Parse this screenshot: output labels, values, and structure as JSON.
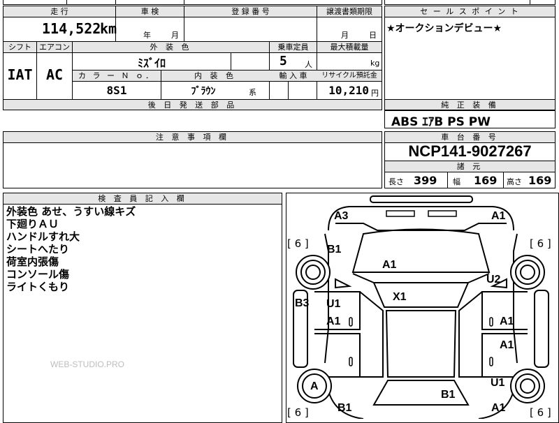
{
  "top_strip": {
    "mileage_label": "走 行",
    "inspection_label": "車 検",
    "registration_label": "登 録 番 号",
    "transfer_deadline_label": "譲渡書類期限"
  },
  "mileage": {
    "value": "114,522",
    "unit": "km"
  },
  "inspection": {
    "year_label": "年",
    "month_label": "月"
  },
  "transfer": {
    "month_label": "月",
    "day_label": "日"
  },
  "row2_labels": {
    "shift": "シフト",
    "aircon": "エアコン",
    "exterior_color": "外 装 色",
    "capacity": "乗車定員",
    "max_load": "最大積載量"
  },
  "shift": "IAT",
  "aircon": "AC",
  "exterior_color": "ﾐｽﾞｲﾛ",
  "capacity": {
    "value": "5",
    "unit": "人"
  },
  "max_load": {
    "unit": "kg"
  },
  "row3_labels": {
    "color_no": "カ ラ ー Ｎ ｏ．",
    "interior_color": "内 装 色",
    "import": "輸 入 車",
    "recycle_fee": "リサイクル預託金"
  },
  "color_no": "8S1",
  "interior_color": {
    "value": "ﾌﾞﾗｳﾝ",
    "suffix": "系"
  },
  "recycle_fee": {
    "value": "10,210",
    "unit": "円"
  },
  "parts_later_label": "後 日 発 送 部 品",
  "sales_point": {
    "label": "セ ー ル ス ポ イ ン ト",
    "text": "★オークションデビュー★"
  },
  "standard_equipment": {
    "label": "純 正 装 備",
    "text": "ABS ｴｱB PS PW"
  },
  "notes_label": "注 意 事 項 欄",
  "chassis": {
    "label": "車 台 番 号",
    "value": "NCP141-9027267"
  },
  "specs": {
    "label": "諸 元",
    "length_label": "長さ",
    "length": "399",
    "width_label": "幅",
    "width": "169",
    "height_label": "高さ",
    "height": "169"
  },
  "inspector": {
    "label": "検 査 員 記 入 欄",
    "remarks": [
      "外装色 あせ、うすい線キズ",
      "下廻りＡＵ",
      "ハンドルすれ大",
      "シートへたり",
      "荷室内張傷",
      "コンソール傷",
      "ライトくもり"
    ]
  },
  "watermark": "WEB-STUDIO.PRO",
  "diagram": {
    "tire_left_top": "[ 6 ]",
    "tire_right_top": "[ 6 ]",
    "tire_left_bottom": "[ 6 ]",
    "tire_right_bottom": "[ 6 ]",
    "codes": {
      "a3": "A3",
      "a1_top_right": "A1",
      "b1_left_front": "B1",
      "a1_hood": "A1",
      "u2_right_front": "U2",
      "x1_windshield": "X1",
      "b3_left": "B3",
      "u1_left_door": "U1",
      "a1_left_door": "A1",
      "a1_right_door_front": "A1",
      "a1_right_door_rear": "A1",
      "a_left_rear_wheel": "A",
      "u1_right_rear": "U1",
      "b1_left_rear": "B1",
      "b1_rear_center": "B1",
      "a1_right_rear": "A1"
    }
  }
}
